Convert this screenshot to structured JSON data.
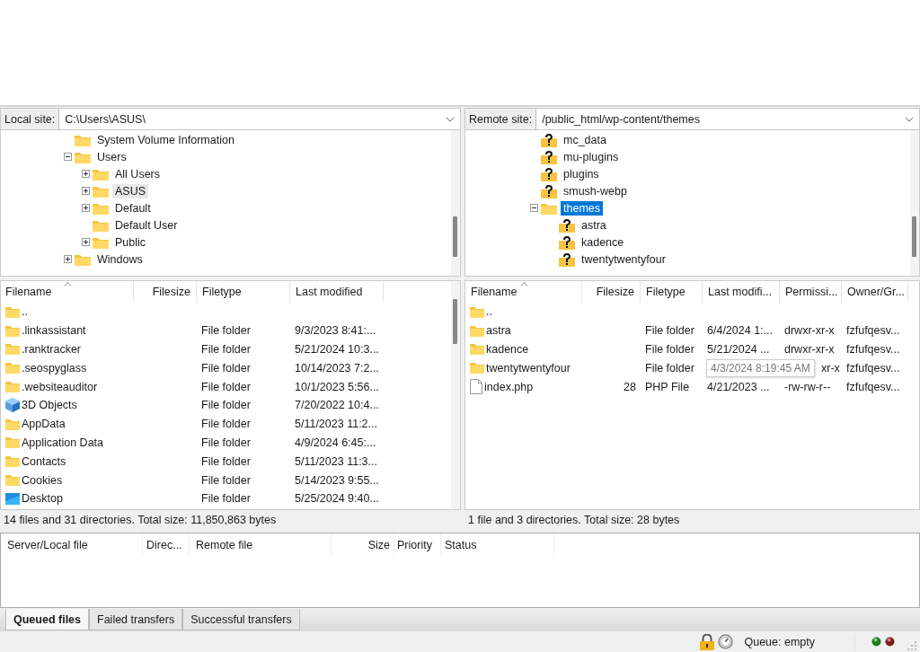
{
  "panes": [
    {
      "site_label": "Local site:",
      "site_path": "C:\\Users\\ASUS\\",
      "tree_focused": false,
      "tree": [
        {
          "name": "System Volume Information",
          "kind": "folder",
          "selected": false
        },
        {
          "name": "Users",
          "kind": "folder",
          "expanded": true,
          "selected": false,
          "children": [
            {
              "name": "All Users",
              "kind": "folder",
              "expanded": false,
              "selected": false
            },
            {
              "name": "ASUS",
              "kind": "folder",
              "expanded": false,
              "selected": true
            },
            {
              "name": "Default",
              "kind": "folder",
              "expanded": false,
              "selected": false
            },
            {
              "name": "Default User",
              "kind": "folder",
              "selected": false
            },
            {
              "name": "Public",
              "kind": "folder",
              "expanded": false,
              "selected": false
            }
          ]
        },
        {
          "name": "Windows",
          "kind": "folder",
          "expanded": false,
          "selected": false
        }
      ],
      "columns": [
        {
          "label": "Filename",
          "sorted": true
        },
        {
          "label": "Filesize",
          "sorted": false
        },
        {
          "label": "Filetype",
          "sorted": false
        },
        {
          "label": "Last modified",
          "sorted": false
        }
      ],
      "rows": [
        {
          "kind": "folder",
          "cells": [
            "..",
            "",
            "",
            ""
          ]
        },
        {
          "kind": "folder",
          "cells": [
            ".linkassistant",
            "",
            "File folder",
            "9/3/2023 8:41:..."
          ]
        },
        {
          "kind": "folder",
          "cells": [
            ".ranktracker",
            "",
            "File folder",
            "5/21/2024 10:3..."
          ]
        },
        {
          "kind": "folder",
          "cells": [
            ".seospyglass",
            "",
            "File folder",
            "10/14/2023 7:2..."
          ]
        },
        {
          "kind": "folder",
          "cells": [
            ".websiteauditor",
            "",
            "File folder",
            "10/1/2023 5:56..."
          ]
        },
        {
          "kind": "cube",
          "cells": [
            "3D Objects",
            "",
            "File folder",
            "7/20/2022 10:4..."
          ]
        },
        {
          "kind": "folder",
          "cells": [
            "AppData",
            "",
            "File folder",
            "5/11/2023 11:2..."
          ]
        },
        {
          "kind": "folder",
          "cells": [
            "Application Data",
            "",
            "File folder",
            "4/9/2024 6:45:..."
          ]
        },
        {
          "kind": "folder",
          "cells": [
            "Contacts",
            "",
            "File folder",
            "5/11/2023 11:3..."
          ]
        },
        {
          "kind": "folder",
          "cells": [
            "Cookies",
            "",
            "File folder",
            "5/14/2023 9:55..."
          ]
        },
        {
          "kind": "desktop",
          "cells": [
            "Desktop",
            "",
            "File folder",
            "5/25/2024 9:40..."
          ]
        }
      ],
      "status": "14 files and 31 directories. Total size: 11,850,863 bytes"
    },
    {
      "site_label": "Remote site:",
      "site_path": "/public_html/wp-content/themes",
      "tree_focused": true,
      "tree": [
        {
          "name": "mc_data",
          "kind": "unknown",
          "selected": false
        },
        {
          "name": "mu-plugins",
          "kind": "unknown",
          "selected": false
        },
        {
          "name": "plugins",
          "kind": "unknown",
          "selected": false
        },
        {
          "name": "smush-webp",
          "kind": "unknown",
          "selected": false
        },
        {
          "name": "themes",
          "kind": "folder",
          "expanded": true,
          "selected": true,
          "children": [
            {
              "name": "astra",
              "kind": "unknown",
              "selected": false
            },
            {
              "name": "kadence",
              "kind": "unknown",
              "selected": false
            },
            {
              "name": "twentytwentyfour",
              "kind": "unknown",
              "selected": false
            }
          ]
        }
      ],
      "columns": [
        {
          "label": "Filename",
          "sorted": true
        },
        {
          "label": "Filesize",
          "sorted": false
        },
        {
          "label": "Filetype",
          "sorted": false
        },
        {
          "label": "Last modifi...",
          "sorted": false
        },
        {
          "label": "Permissi...",
          "sorted": false
        },
        {
          "label": "Owner/Gr...",
          "sorted": false
        }
      ],
      "rows": [
        {
          "kind": "folder",
          "cells": [
            "..",
            "",
            "",
            "",
            "",
            ""
          ]
        },
        {
          "kind": "folder",
          "cells": [
            "astra",
            "",
            "File folder",
            "6/4/2024 1:...",
            "drwxr-xr-x",
            "fzfufqesv..."
          ]
        },
        {
          "kind": "folder",
          "cells": [
            "kadence",
            "",
            "File folder",
            "5/21/2024 ...",
            "drwxr-xr-x",
            "fzfufqesv..."
          ]
        },
        {
          "kind": "folder",
          "cells": [
            "twentytwentyfour",
            "",
            "File folder",
            "",
            "xr-x",
            "fzfufqesv..."
          ]
        },
        {
          "kind": "file",
          "cells": [
            "index.php",
            "28",
            "PHP File",
            "4/21/2023 ...",
            "-rw-rw-r--",
            "fzfufqesv..."
          ]
        }
      ],
      "tooltip": "4/3/2024 8:19:45 AM",
      "status": "1 file and 3 directories. Total size: 28 bytes"
    }
  ],
  "queue": {
    "columns": [
      "Server/Local file",
      "Direc...",
      "Remote file",
      "Size",
      "Priority",
      "Status"
    ]
  },
  "queue_tabs": [
    {
      "label": "Queued files",
      "selected": true
    },
    {
      "label": "Failed transfers",
      "selected": false
    },
    {
      "label": "Successful transfers",
      "selected": false
    }
  ],
  "status_bar": {
    "queue": "Queue: empty"
  }
}
